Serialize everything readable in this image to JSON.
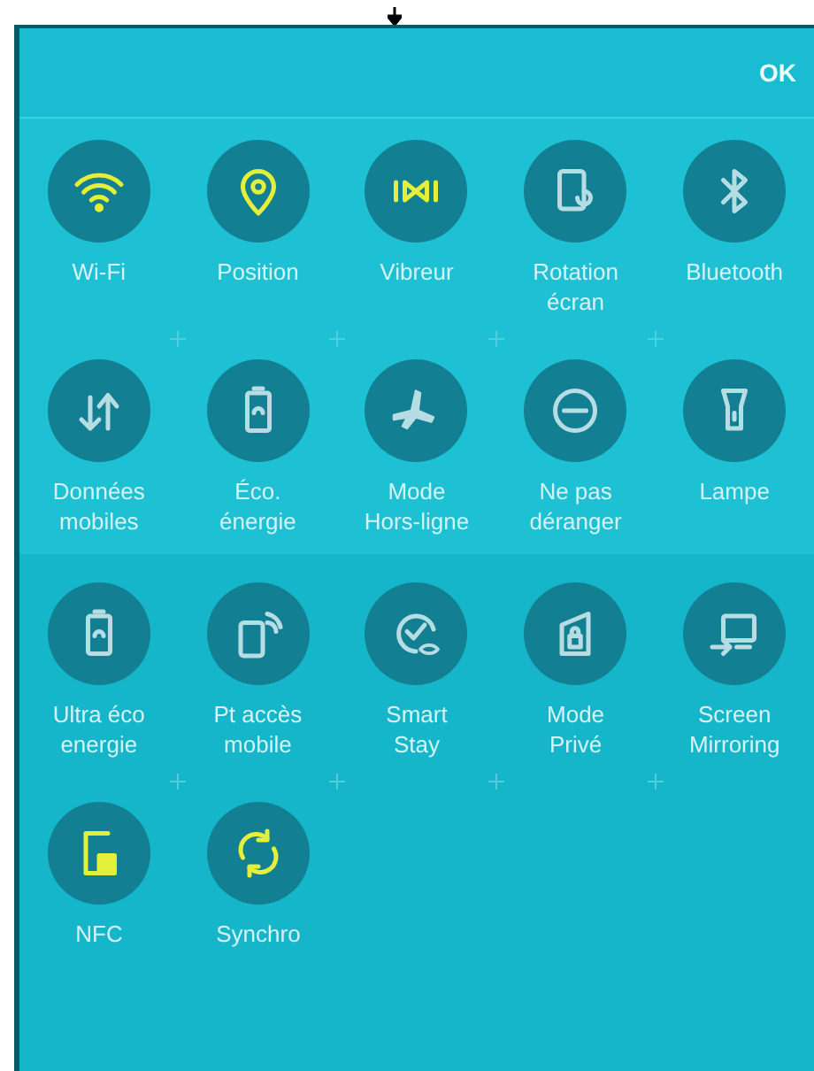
{
  "header": {
    "ok": "OK"
  },
  "sections": [
    {
      "rows": [
        [
          {
            "label": "Wi-Fi",
            "on": true
          },
          {
            "label": "Position",
            "on": true
          },
          {
            "label": "Vibreur",
            "on": true
          },
          {
            "label": "Rotation\nécran",
            "on": false
          },
          {
            "label": "Bluetooth",
            "on": false
          }
        ],
        [
          {
            "label": "Données\nmobiles",
            "on": false
          },
          {
            "label": "Éco.\nénergie",
            "on": false
          },
          {
            "label": "Mode\nHors-ligne",
            "on": false
          },
          {
            "label": "Ne pas\ndéranger",
            "on": false
          },
          {
            "label": "Lampe",
            "on": false
          }
        ]
      ]
    },
    {
      "rows": [
        [
          {
            "label": "Ultra éco\nenergie",
            "on": false
          },
          {
            "label": "Pt accès\nmobile",
            "on": false
          },
          {
            "label": "Smart\nStay",
            "on": false
          },
          {
            "label": "Mode\nPrivé",
            "on": false
          },
          {
            "label": "Screen\nMirroring",
            "on": false
          }
        ],
        [
          {
            "label": "NFC",
            "on": true
          },
          {
            "label": "Synchro",
            "on": true
          }
        ]
      ]
    }
  ]
}
